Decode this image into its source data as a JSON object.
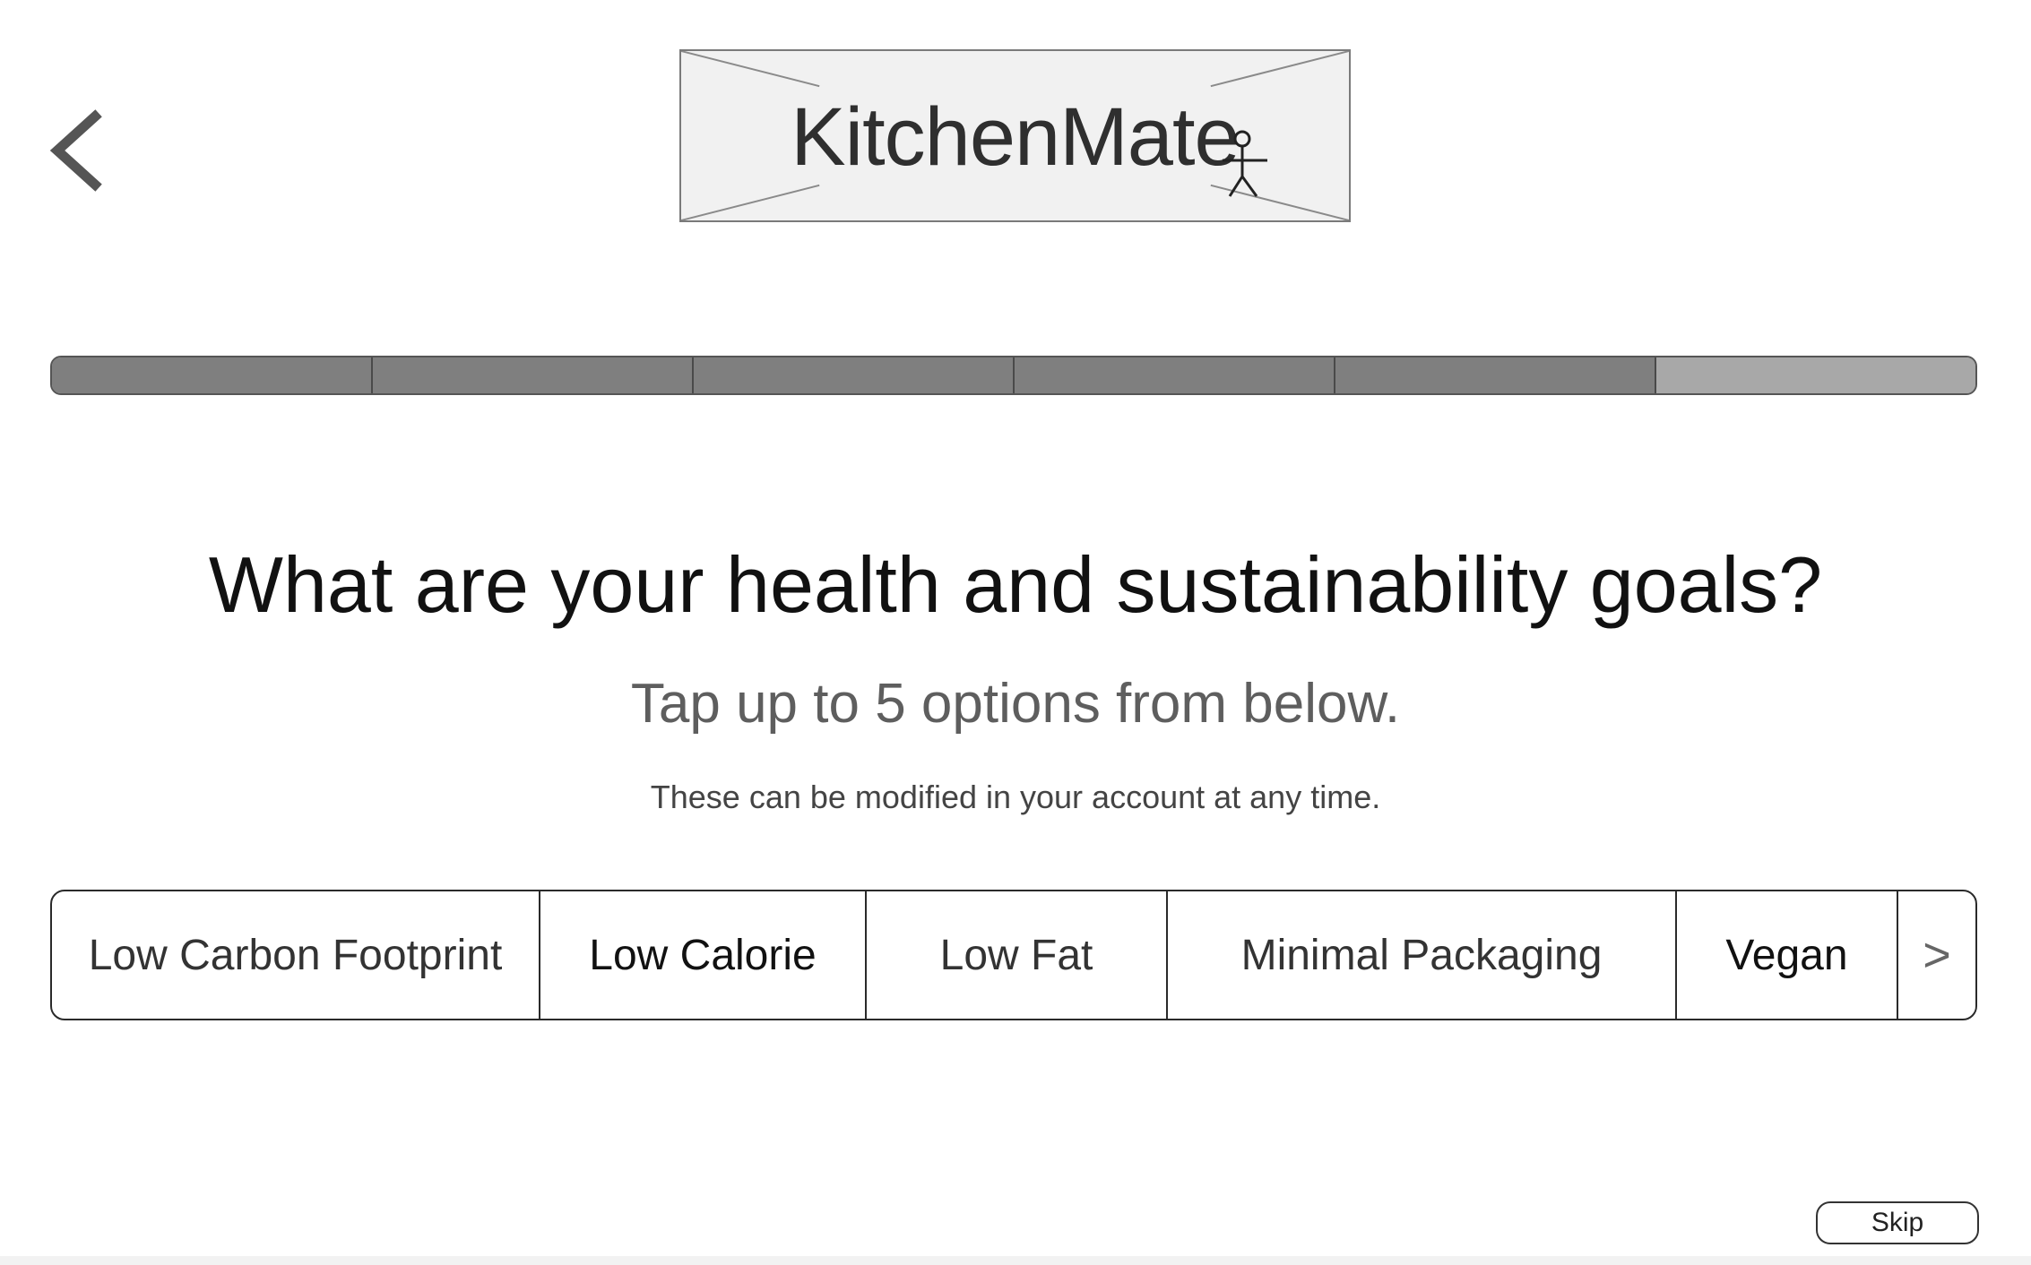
{
  "header": {
    "back_icon": "chevron-left-icon",
    "logo_text": "KitchenMate",
    "logo_figure_icon": "stick-figure-icon"
  },
  "progress": {
    "total_steps": 6,
    "completed_steps": 5,
    "completed_color": "#7f7f7f",
    "remaining_color": "#a8a8a8"
  },
  "main": {
    "question": "What are your health and sustainability goals?",
    "subtitle": "Tap up to 5 options from below.",
    "note": "These can be modified in your account at any time."
  },
  "options": [
    {
      "label": "Low Carbon Footprint"
    },
    {
      "label": "Low Calorie"
    },
    {
      "label": "Low Fat"
    },
    {
      "label": "Minimal Packaging"
    },
    {
      "label": "Vegan"
    }
  ],
  "options_next_label": ">",
  "footer": {
    "skip_label": "Skip"
  }
}
